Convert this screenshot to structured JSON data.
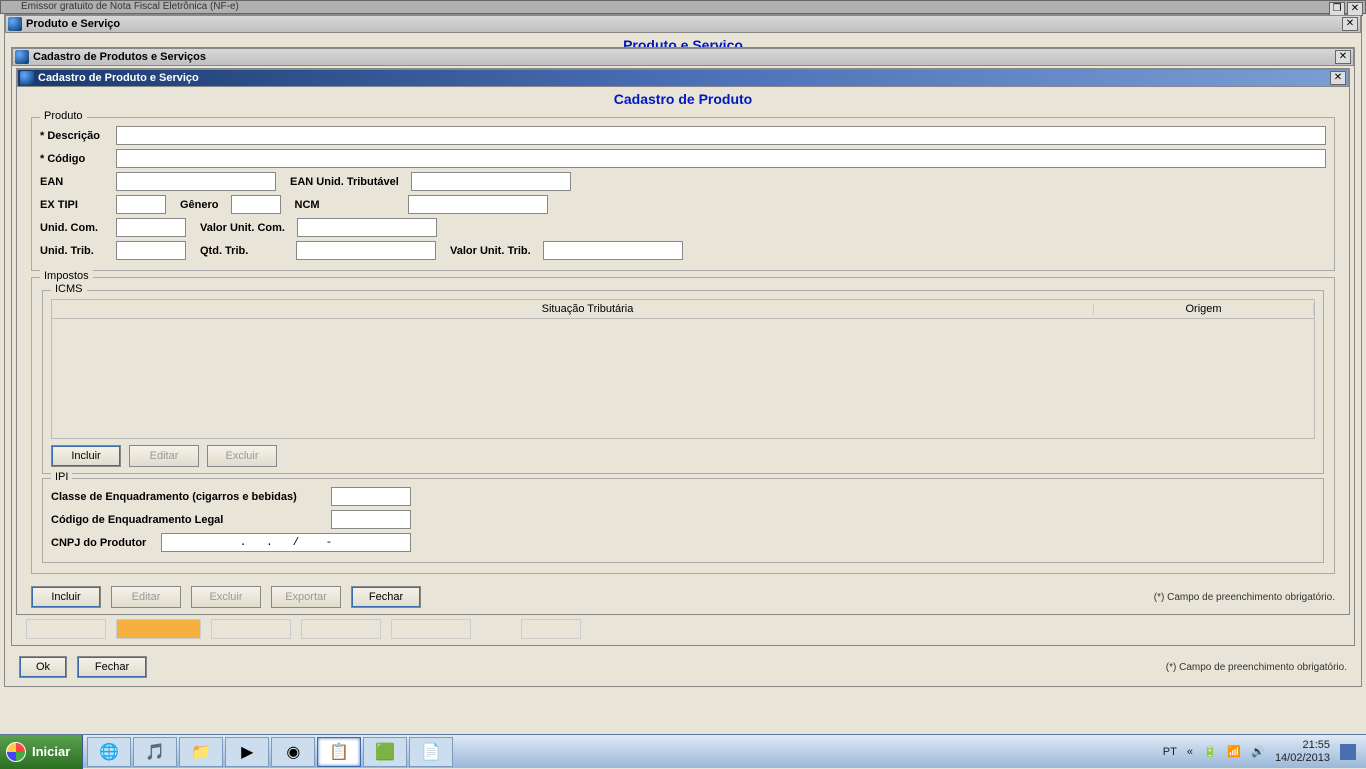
{
  "topmost_title": "Emissor gratuito de Nota Fiscal Eletrônica (NF-e)",
  "window1_title": "Produto e Serviço",
  "window1_heading": "Produto e Serviço",
  "window2_title": "Cadastro de Produtos e Serviços",
  "window3_title": "Cadastro de Produto e Serviço",
  "page_heading": "Cadastro de Produto",
  "groups": {
    "produto": "Produto",
    "impostos": "Impostos",
    "icms": "ICMS",
    "ipi": "IPI"
  },
  "labels": {
    "descricao": "Descrição",
    "codigo": "Código",
    "ean": "EAN",
    "ean_trib": "EAN Unid. Tributável",
    "ex_tipi": "EX TIPI",
    "genero": "Gênero",
    "ncm": "NCM",
    "unid_com": "Unid. Com.",
    "valor_unit_com": "Valor Unit. Com.",
    "unid_trib": "Unid. Trib.",
    "qtd_trib": "Qtd. Trib.",
    "valor_unit_trib": "Valor Unit. Trib.",
    "classe_enq": "Classe de Enquadramento (cigarros e bebidas)",
    "cod_enq": "Código de Enquadramento Legal",
    "cnpj_prod": "CNPJ do Produtor"
  },
  "table": {
    "col1": "Situação Tributária",
    "col2": "Origem"
  },
  "buttons": {
    "incluir": "Incluir",
    "editar": "Editar",
    "excluir": "Excluir",
    "exportar": "Exportar",
    "fechar": "Fechar",
    "ok": "Ok"
  },
  "hint": "(*) Campo de preenchimento obrigatório.",
  "cnpj_mask": "  .   .   /    -  ",
  "taskbar": {
    "start": "Iniciar",
    "lang": "PT",
    "time": "21:55",
    "date": "14/02/2013"
  }
}
